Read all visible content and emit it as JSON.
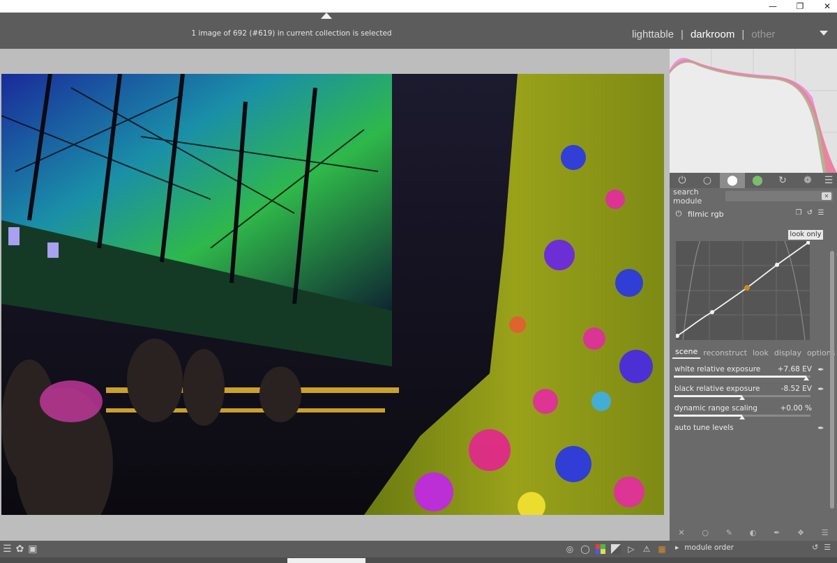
{
  "window": {
    "minimize_icon": "minimize-icon",
    "restore_icon": "restore-icon",
    "close_icon": "close-icon"
  },
  "header": {
    "selection_info": "1 image of 692 (#619) in current collection is selected",
    "views": {
      "lighttable": "lighttable",
      "darkroom": "darkroom",
      "other": "other",
      "separator": "|"
    }
  },
  "right_panel": {
    "search": {
      "label": "search module",
      "value": "",
      "placeholder": ""
    },
    "module": {
      "name": "filmic rgb",
      "look_only_label": "look only",
      "tabs": [
        "scene",
        "reconstruct",
        "look",
        "display",
        "options"
      ],
      "active_tab": "scene",
      "sliders": [
        {
          "label": "white relative exposure",
          "value": "+7.68 EV",
          "fraction": 0.97
        },
        {
          "label": "black relative exposure",
          "value": "-8.52 EV",
          "fraction": 0.5
        },
        {
          "label": "dynamic range scaling",
          "value": "+0.00 %",
          "fraction": 0.5
        }
      ],
      "auto_tune_label": "auto tune levels"
    },
    "module_order_label": "module order"
  },
  "colors": {
    "panel_bg": "#6a6a6a",
    "header_bg": "#5c5c5c",
    "center_bg": "#bdbdbd",
    "curve_orange": "#c98a1e"
  }
}
